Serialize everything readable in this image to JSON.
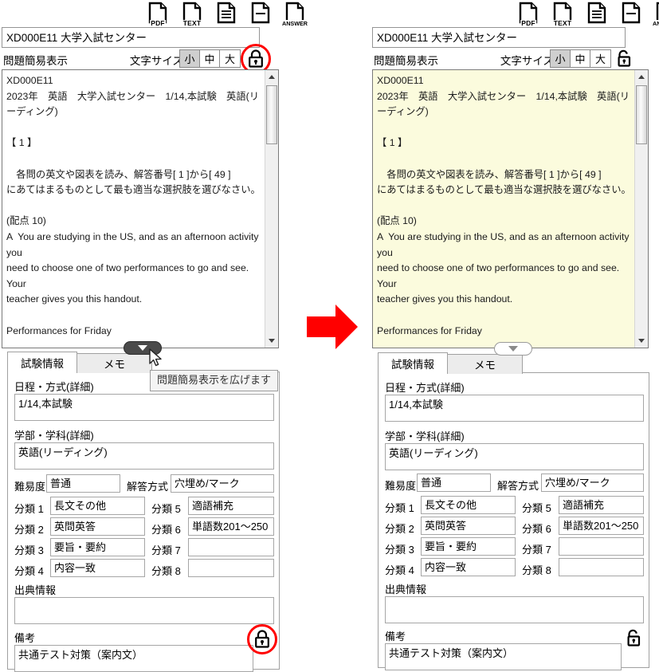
{
  "toolbar": {
    "icons": [
      {
        "name": "pdf-doc-icon",
        "label": "PDF",
        "style": "plain"
      },
      {
        "name": "text-doc-icon",
        "label": "TEXT",
        "style": "plain"
      },
      {
        "name": "lines-doc-icon",
        "label": "",
        "style": "lines"
      },
      {
        "name": "dash-doc-icon",
        "label": "",
        "style": "dash"
      },
      {
        "name": "answer-doc-icon",
        "label": "ANSWER",
        "style": "plain"
      }
    ]
  },
  "header": {
    "title_value": "XD000E11 大学入試センター",
    "simple_view_label": "問題簡易表示",
    "font_size_label": "文字サイズ",
    "font_size_options": [
      "小",
      "中",
      "大"
    ],
    "font_size_selected": "小"
  },
  "viewer": {
    "body": "XD000E11\n2023年　英語　大学入試センター　1/14,本試験　英語(リーディング)\n\n【 1 】\n\n　各問の英文や図表を読み、解答番号[ 1 ]から[ 49 ]\nにあてはまるものとして最も適当な選択肢を選びなさい。\n\n(配点 10)\nA  You are studying in the US, and as an afternoon activity you\nneed to choose one of two performances to go and see. Your\nteacher gives you this handout.\n\nPerformances for Friday\n\nPalace Theater\nTogether Wherever　　　　Grand Theater\nThe Guitar Queen\nA romantic play that will make you laugh and cry　　　A rock m\nfeaturing colorful costumes\n▶From 2:00 p.m. (no breaks and a running time of one hour and"
  },
  "expand": {
    "tooltip": "問題簡易表示を広げます"
  },
  "tabs": [
    {
      "label": "試験情報",
      "active": true
    },
    {
      "label": "メモ",
      "active": false
    }
  ],
  "form": {
    "schedule_label": "日程・方式(詳細)",
    "schedule_value": "1/14,本試験",
    "faculty_label": "学部・学科(詳細)",
    "faculty_value": "英語(リーディング)",
    "difficulty_label": "難易度",
    "difficulty_value": "普通",
    "answer_style_label": "解答方式",
    "answer_style_value": "穴埋め/マーク",
    "categories": [
      {
        "label": "分類 1",
        "value": "長文その他"
      },
      {
        "label": "分類 2",
        "value": "英問英答"
      },
      {
        "label": "分類 3",
        "value": "要旨・要約"
      },
      {
        "label": "分類 4",
        "value": "内容一致"
      },
      {
        "label": "分類 5",
        "value": "適語補充"
      },
      {
        "label": "分類 6",
        "value": "単語数201〜250"
      },
      {
        "label": "分類 7",
        "value": ""
      },
      {
        "label": "分類 8",
        "value": ""
      }
    ],
    "source_label": "出典情報",
    "source_value": "",
    "remarks_label": "備考",
    "remarks_value": "共通テスト対策（案内文）"
  },
  "states": {
    "left_lock": "locked",
    "right_lock": "unlocked",
    "highlight_color": "#ff0000",
    "viewer_bg_left": "#ffffff",
    "viewer_bg_right": "#fbfbdd"
  }
}
